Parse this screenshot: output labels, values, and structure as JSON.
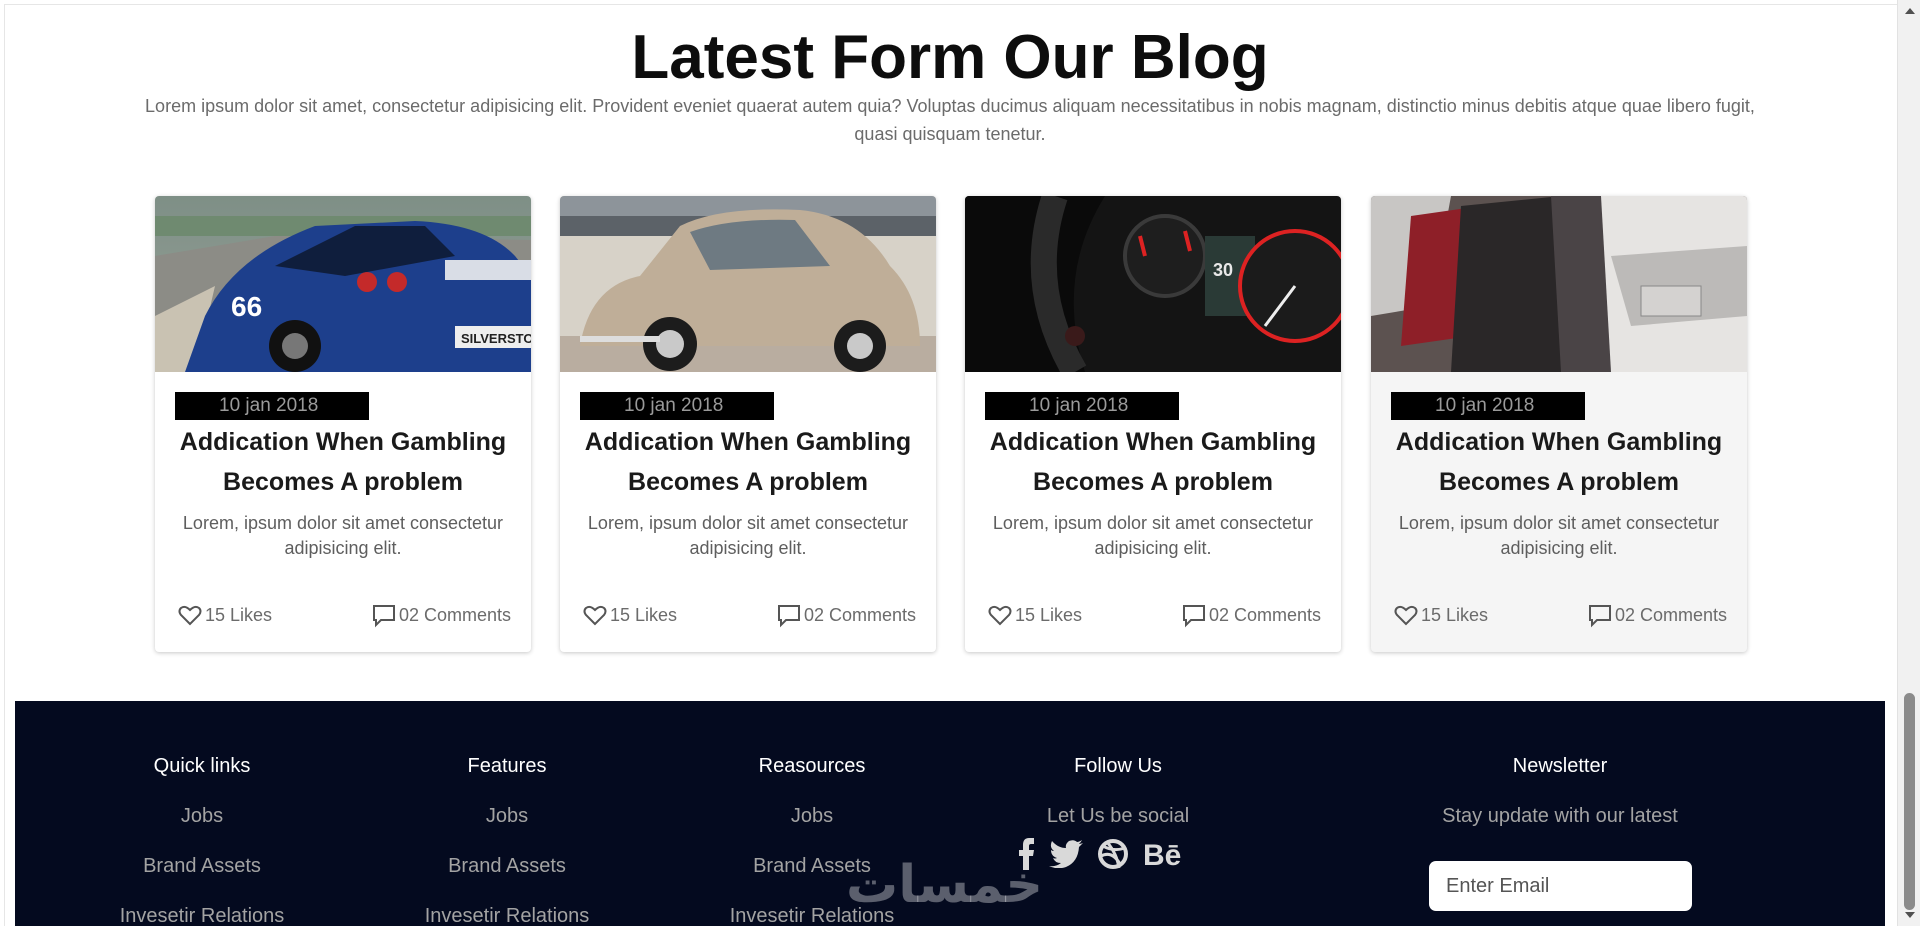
{
  "blog": {
    "title": "Latest Form Our Blog",
    "subtitle": "Lorem ipsum dolor sit amet, consectetur adipisicing elit. Provident eveniet quaerat autem quia? Voluptas ducimus aliquam necessitatibus in nobis magnam, distinctio minus debitis atque quae libero fugit, quasi quisquam tenetur."
  },
  "cards": [
    {
      "image_icon": "blue-race-car-photo",
      "date": "10 jan 2018",
      "title": "Addication When Gambling Becomes A problem",
      "text": "Lorem, ipsum dolor sit amet consectetur adipisicing elit.",
      "likes": "15 Likes",
      "comments": "02 Comments"
    },
    {
      "image_icon": "vintage-beetle-car-photo",
      "date": "10 jan 2018",
      "title": "Addication When Gambling Becomes A problem",
      "text": "Lorem, ipsum dolor sit amet consectetur adipisicing elit.",
      "likes": "15 Likes",
      "comments": "02 Comments"
    },
    {
      "image_icon": "car-dashboard-photo",
      "date": "10 jan 2018",
      "title": "Addication When Gambling Becomes A problem",
      "text": "Lorem, ipsum dolor sit amet consectetur adipisicing elit.",
      "likes": "15 Likes",
      "comments": "02 Comments"
    },
    {
      "image_icon": "parked-cars-row-photo",
      "date": "10 jan 2018",
      "title": "Addication When Gambling Becomes A problem",
      "text": "Lorem, ipsum dolor sit amet consectetur adipisicing elit.",
      "likes": "15 Likes",
      "comments": "02 Comments"
    }
  ],
  "footer": {
    "columns": [
      {
        "title": "Quick links",
        "links": [
          "Jobs",
          "Brand Assets",
          "Invesetir Relations"
        ]
      },
      {
        "title": "Features",
        "links": [
          "Jobs",
          "Brand Assets",
          "Invesetir Relations"
        ]
      },
      {
        "title": "Reasources",
        "links": [
          "Jobs",
          "Brand Assets",
          "Invesetir Relations"
        ]
      }
    ],
    "follow": {
      "title": "Follow Us",
      "text": "Let Us be social",
      "icons": [
        "facebook-icon",
        "twitter-icon",
        "dribbble-icon",
        "behance-icon"
      ]
    },
    "newsletter": {
      "title": "Newsletter",
      "text": "Stay update with our latest",
      "placeholder": "Enter Email"
    }
  },
  "watermark": {
    "text": "خمسات"
  },
  "colors": {
    "footer_bg": "#040a1f",
    "date_bg": "#000000",
    "accent_text": "#0d0d0d"
  }
}
